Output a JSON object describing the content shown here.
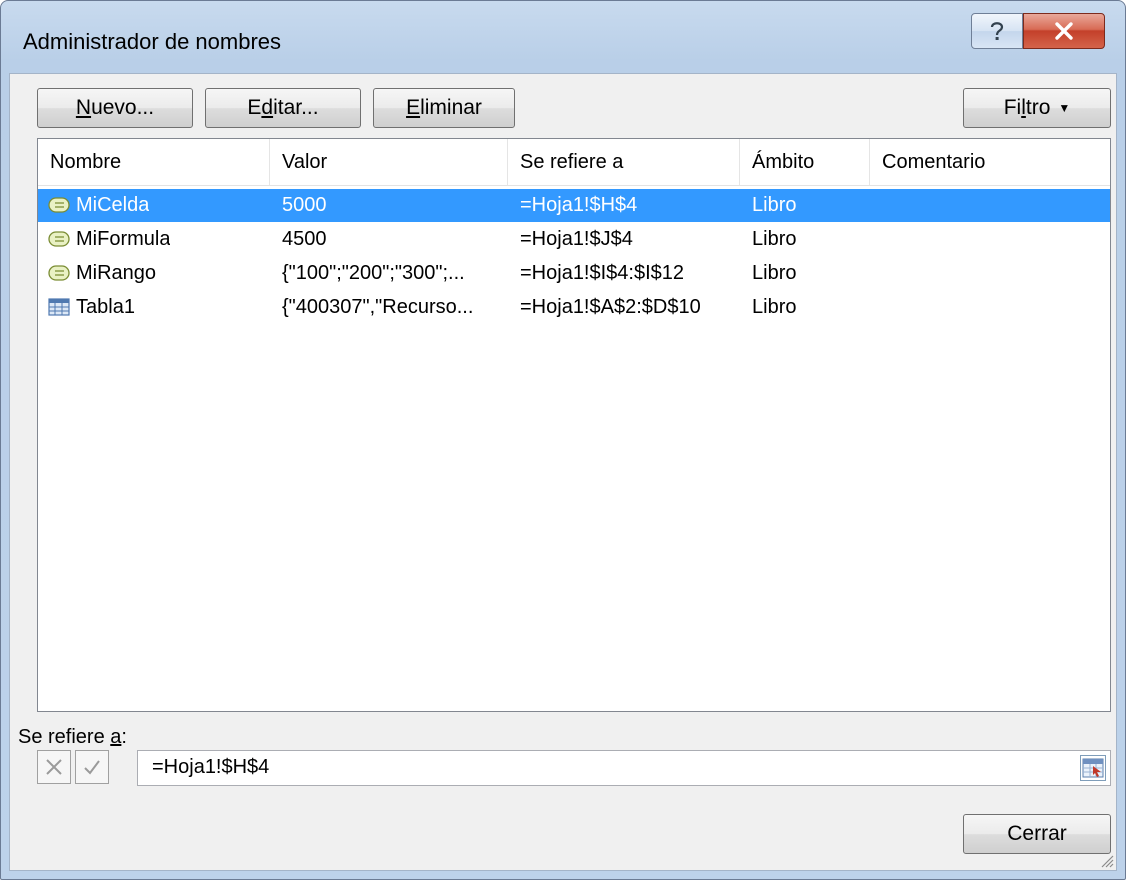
{
  "window": {
    "title": "Administrador de nombres"
  },
  "toolbar": {
    "nuevo": {
      "prefix": "",
      "mnemonic": "N",
      "suffix": "uevo..."
    },
    "editar": {
      "prefix": "E",
      "mnemonic": "d",
      "suffix": "itar..."
    },
    "eliminar": {
      "prefix": "",
      "mnemonic": "E",
      "suffix": "liminar"
    },
    "filtro": {
      "prefix": "Fi",
      "mnemonic": "l",
      "suffix": "tro"
    }
  },
  "table": {
    "columns": [
      "Nombre",
      "Valor",
      "Se refiere a",
      "Ámbito",
      "Comentario"
    ],
    "rows": [
      {
        "icon": "named-cell-icon",
        "name": "MiCelda",
        "value": "5000",
        "refers_to": "=Hoja1!$H$4",
        "scope": "Libro",
        "comment": "",
        "selected": true
      },
      {
        "icon": "named-cell-icon",
        "name": "MiFormula",
        "value": "4500",
        "refers_to": "=Hoja1!$J$4",
        "scope": "Libro",
        "comment": "",
        "selected": false
      },
      {
        "icon": "named-cell-icon",
        "name": "MiRango",
        "value": "{\"100\";\"200\";\"300\";...",
        "refers_to": "=Hoja1!$I$4:$I$12",
        "scope": "Libro",
        "comment": "",
        "selected": false
      },
      {
        "icon": "table-icon",
        "name": "Tabla1",
        "value": "{\"400307\",\"Recurso...",
        "refers_to": "=Hoja1!$A$2:$D$10",
        "scope": "Libro",
        "comment": "",
        "selected": false
      }
    ]
  },
  "refers_to": {
    "label_prefix": "Se refiere ",
    "label_mnemonic": "a",
    "label_suffix": ":",
    "value": "=Hoja1!$H$4"
  },
  "footer": {
    "close_label": "Cerrar"
  },
  "colors": {
    "selection": "#3399ff",
    "close_button": "#c94b34"
  }
}
